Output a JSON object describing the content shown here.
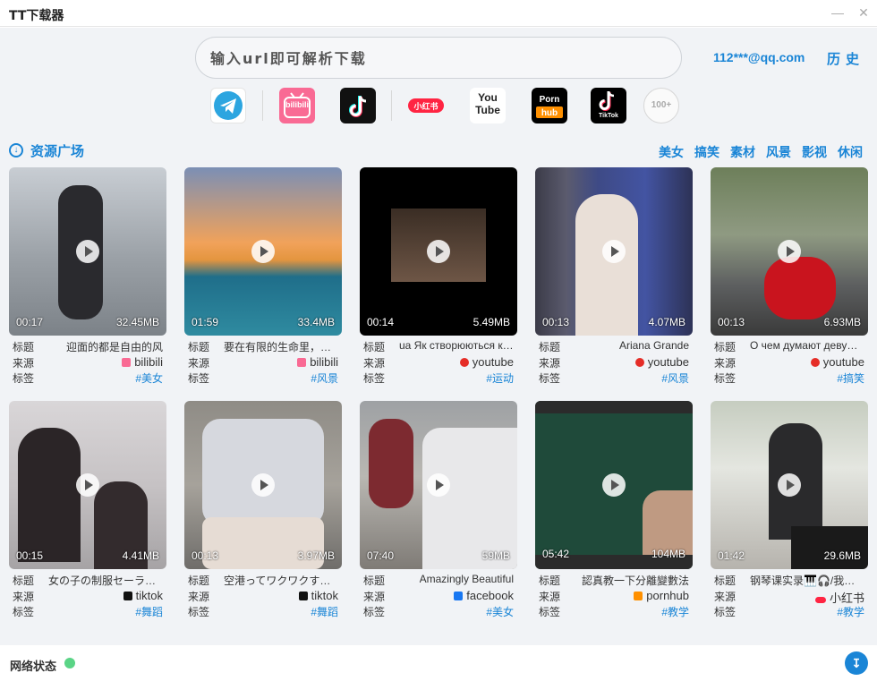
{
  "window": {
    "title": "TT下载器",
    "minimize_icon": "minimize-icon",
    "close_icon": "close-icon"
  },
  "search": {
    "placeholder": "输入url即可解析下载"
  },
  "header": {
    "user": "112***@qq.com",
    "history": "历史"
  },
  "platforms": [
    {
      "name": "telegram",
      "label": "",
      "icon": "telegram-icon"
    },
    {
      "name": "bilibili",
      "label": "bilibili",
      "icon": "bilibili-icon"
    },
    {
      "name": "tiktok",
      "label": "",
      "icon": "tiktok-icon"
    },
    {
      "name": "xiaohongshu",
      "label": "小红书",
      "icon": "xiaohongshu-icon"
    },
    {
      "name": "youtube",
      "label": "You Tube",
      "icon": "youtube-icon"
    },
    {
      "name": "pornhub",
      "label": "Porn hub",
      "icon": "pornhub-icon"
    },
    {
      "name": "tiktok-alt",
      "label": "TikTok",
      "icon": "tiktok-icon"
    }
  ],
  "more_label": "100+",
  "section": {
    "title": "资源广场",
    "categories": [
      "美女",
      "搞笑",
      "素材",
      "风景",
      "影视",
      "休闲"
    ]
  },
  "labels": {
    "title": "标题",
    "source": "来源",
    "tag": "标签"
  },
  "cards": [
    {
      "duration": "00:17",
      "size": "32.45MB",
      "title": "迎面的都是自由的风",
      "source": "bilibili",
      "tag": "#美女"
    },
    {
      "duration": "01:59",
      "size": "33.4MB",
      "title": "要在有限的生命里，去无限的热爱",
      "source": "bilibili",
      "tag": "#风景"
    },
    {
      "duration": "00:14",
      "size": "5.49MB",
      "title": "ua Як створюються красиві відео",
      "source": "youtube",
      "tag": "#运动"
    },
    {
      "duration": "00:13",
      "size": "4.07MB",
      "title": "Ariana Grande",
      "source": "youtube",
      "tag": "#风景"
    },
    {
      "duration": "00:13",
      "size": "6.93MB",
      "title": "О чем думают девушки на мотоцикле",
      "source": "youtube",
      "tag": "#搞笑"
    },
    {
      "duration": "00:15",
      "size": "4.41MB",
      "title": "女の子の制服セーラー派ブレザー派",
      "source": "tiktok",
      "tag": "#舞蹈"
    },
    {
      "duration": "00:13",
      "size": "3.97MB",
      "title": "空港ってワクワクするよね",
      "source": "tiktok",
      "tag": "#舞蹈"
    },
    {
      "duration": "07:40",
      "size": "59MB",
      "title": "Amazingly Beautiful",
      "source": "facebook",
      "tag": "#美女"
    },
    {
      "duration": "05:42",
      "size": "104MB",
      "title": "認真教一下分離變數法",
      "source": "pornhub",
      "tag": "#教学"
    },
    {
      "duration": "01:42",
      "size": "29.6MB",
      "title": "钢琴课实录🎹🎧/我的日常",
      "source": "小红书",
      "tag": "#教学"
    }
  ],
  "footer": {
    "network_label": "网络状态",
    "network_status_color": "#5ad486",
    "download_icon": "download-icon"
  },
  "colors": {
    "accent": "#1a85d6",
    "background": "#f1f3f6"
  }
}
